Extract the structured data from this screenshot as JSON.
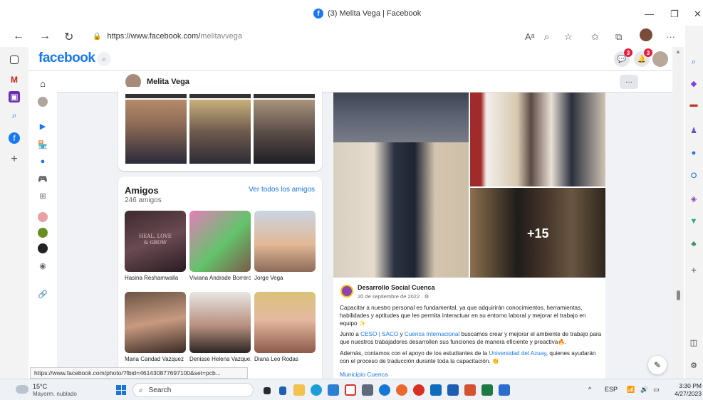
{
  "browser": {
    "tab_title": "(3) Melita Vega | Facebook",
    "url_host": "https://www.facebook.com/",
    "url_path": "melitavvega",
    "window_controls": [
      "minimize-icon",
      "restore-icon",
      "close-icon"
    ],
    "nav": [
      "back-icon",
      "forward-icon",
      "refresh-icon"
    ],
    "status_url": "https://www.facebook.com/photo/?fbid=461430877697100&set=pcb..."
  },
  "facebook": {
    "logo": "facebook",
    "notifications": {
      "messenger_count": "3",
      "bell_count": "3"
    },
    "profile_name": "Melita Vega",
    "more_label": "···",
    "friends": {
      "title": "Amigos",
      "count": "246 amigos",
      "see_all": "Ver todos los amigos",
      "list": [
        {
          "name": "Hasina Reshamwalla",
          "pic_text": "HEAL, LOVE & GROW"
        },
        {
          "name": "Viviana Andrade Borrero",
          "pic_text": ""
        },
        {
          "name": "Jorge Vega",
          "pic_text": ""
        },
        {
          "name": "Maria Caridad Vazquez",
          "pic_text": ""
        },
        {
          "name": "Denisse Helena Vazquez",
          "pic_text": ""
        },
        {
          "name": "Diana Leo Rodas",
          "pic_text": ""
        }
      ]
    },
    "post": {
      "more_photos": "+15",
      "author": "Desarrollo Social Cuenca",
      "date": "20 de septiembre de 2022 · ⚙",
      "p1": "Capacitar a nuestro personal es fundamental, ya que adquirirán conocimientos, herramientas, habilidades y aptitudes que les permita interactuar en su entorno laboral y mejorar el trabajo en equipo ✨",
      "p2_a": "Junto a ",
      "p2_link1": "CESO | SACO",
      "p2_b": " y ",
      "p2_link2": "Cuenca Internacional",
      "p2_c": " buscamos crear y mejorar el ambiente de trabajo para que nuestros trabajadores desarrollen sus funciones de manera eficiente y proactiva🔥.",
      "p3_a": "Además, contamos con el apoyo de los estudiantes de la ",
      "p3_link": "Universidad del Azuay",
      "p3_b": ", quienes ayudarán con el proceso de traducción durante toda la capacitación. 👏",
      "tag": "Municipio Cuenca"
    }
  },
  "taskbar": {
    "temp": "15°C",
    "weather": "Mayorm. nublado",
    "search_label": "Search",
    "lang": "ESP",
    "time": "3:30 PM",
    "date": "4/27/2023"
  }
}
